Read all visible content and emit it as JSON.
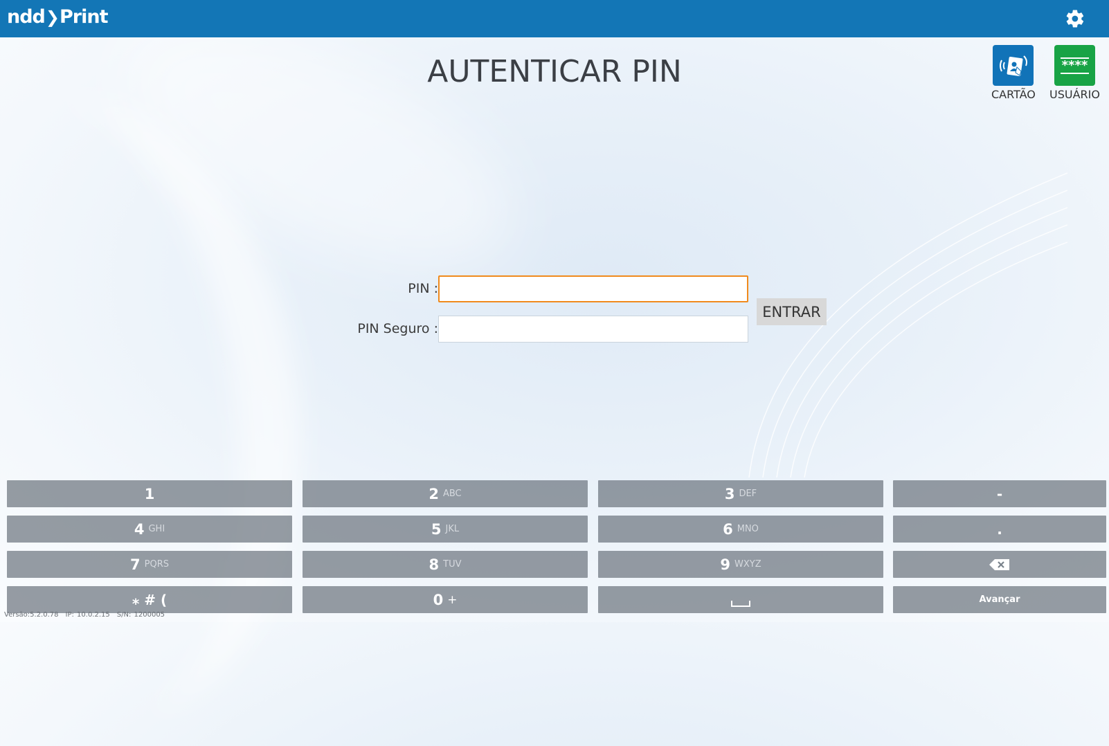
{
  "header": {
    "logo_left": "ndd",
    "logo_right": "Print",
    "settings_icon": "gear-icon",
    "bar_color": "#1376b6"
  },
  "title": "AUTENTICAR PIN",
  "auth_options": [
    {
      "label": "CARTÃO",
      "icon": "card-reader-icon",
      "color": "#1173b8"
    },
    {
      "label": "USUÁRIO",
      "icon": "password-icon",
      "color": "#18a345",
      "icon_text": "****"
    }
  ],
  "form": {
    "pin_label": "PIN :",
    "pin_value": "",
    "pin_secure_label": "PIN Seguro :",
    "pin_secure_value": "",
    "enter_label": "ENTRAR",
    "focus_color": "#f08a1c"
  },
  "keypad": {
    "row1": [
      {
        "digit": "1",
        "letters": ""
      },
      {
        "digit": "2",
        "letters": "ABC"
      },
      {
        "digit": "3",
        "letters": "DEF"
      },
      {
        "digit": "-",
        "letters": ""
      }
    ],
    "row2": [
      {
        "digit": "4",
        "letters": "GHI"
      },
      {
        "digit": "5",
        "letters": "JKL"
      },
      {
        "digit": "6",
        "letters": "MNO"
      },
      {
        "digit": ".",
        "letters": ""
      }
    ],
    "row3": [
      {
        "digit": "7",
        "letters": "PQRS"
      },
      {
        "digit": "8",
        "letters": "TUV"
      },
      {
        "digit": "9",
        "letters": "WXYZ"
      },
      {
        "digit": "",
        "letters": "",
        "icon": "backspace-icon"
      }
    ],
    "row4": [
      {
        "digit": "⁎ # (",
        "letters": ""
      },
      {
        "digit": "0",
        "letters": "+"
      },
      {
        "digit": "",
        "letters": "",
        "icon": "space-icon"
      },
      {
        "digit": "Avançar",
        "letters": ""
      }
    ]
  },
  "footer": {
    "version": "Versão:5.2.0.78",
    "ip": "IP: 10.0.2.15",
    "serial": "S/N: 1200005"
  }
}
